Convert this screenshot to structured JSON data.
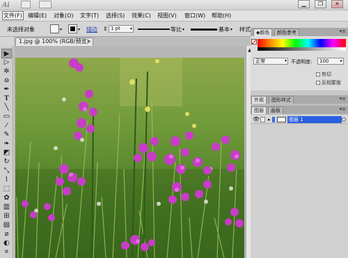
{
  "titlebar": {
    "app_logo": "Ai",
    "window_buttons": [
      "▁",
      "❐",
      "✕"
    ]
  },
  "menu": {
    "items": [
      "文件(F)",
      "编辑(E)",
      "对象(O)",
      "文字(T)",
      "选择(S)",
      "效果(C)",
      "视图(V)",
      "窗口(W)",
      "帮助(H)"
    ]
  },
  "control": {
    "selection_status": "未选择对象",
    "stroke_link": "描边",
    "stroke_weight": "1 pt",
    "uniform_label": "等比",
    "basic_label": "基本",
    "style_label": "样式:",
    "fill_color": "#f5f5f5",
    "stroke_color": "#000000"
  },
  "document": {
    "tab_title": "1.jpg @ 100% (RGB/预览)",
    "close": "✕"
  },
  "tools": [
    {
      "name": "selection-tool",
      "glyph": "▶"
    },
    {
      "name": "direct-selection-tool",
      "glyph": "▷"
    },
    {
      "name": "magic-wand-tool",
      "glyph": "✲"
    },
    {
      "name": "lasso-tool",
      "glyph": "ɷ"
    },
    {
      "name": "pen-tool",
      "glyph": "✒"
    },
    {
      "name": "type-tool",
      "glyph": "T"
    },
    {
      "name": "line-tool",
      "glyph": "╲"
    },
    {
      "name": "rectangle-tool",
      "glyph": "▭"
    },
    {
      "name": "paintbrush-tool",
      "glyph": "⁄"
    },
    {
      "name": "pencil-tool",
      "glyph": "✎"
    },
    {
      "name": "blob-brush-tool",
      "glyph": "❧"
    },
    {
      "name": "eraser-tool",
      "glyph": "◩"
    },
    {
      "name": "rotate-tool",
      "glyph": "↻"
    },
    {
      "name": "scale-tool",
      "glyph": "⤡"
    },
    {
      "name": "warp-tool",
      "glyph": "⌇"
    },
    {
      "name": "free-transform-tool",
      "glyph": "⬚"
    },
    {
      "name": "symbol-sprayer-tool",
      "glyph": "✿"
    },
    {
      "name": "column-graph-tool",
      "glyph": "▥"
    },
    {
      "name": "mesh-tool",
      "glyph": "⊞"
    },
    {
      "name": "gradient-tool",
      "glyph": "▤"
    },
    {
      "name": "eyedropper-tool",
      "glyph": "⌀"
    },
    {
      "name": "blend-tool",
      "glyph": "◐"
    },
    {
      "name": "slice-tool",
      "glyph": "⌗"
    }
  ],
  "panels": {
    "color_tab": "颜色",
    "color_guide_tab": "颜色参考",
    "blend_mode": "正常",
    "opacity_label": "不透明度:",
    "opacity_value": "100",
    "clip_label": "剪切",
    "invert_mask_label": "反相蒙版",
    "appearance_tab": "外观",
    "graphic_styles_tab": "图形样式",
    "layers_tab": "图层",
    "artboards_tab": "画板",
    "layer_name": "图层 1",
    "menu_glyph": "▾≡"
  }
}
